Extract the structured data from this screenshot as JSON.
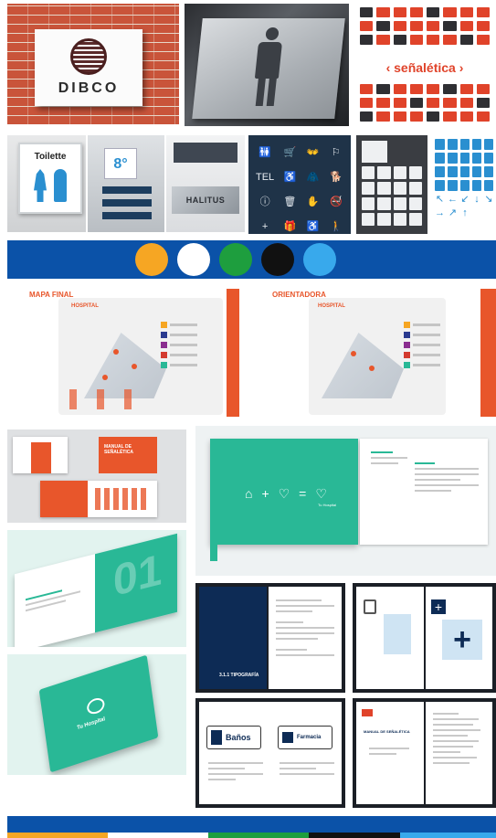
{
  "row1": {
    "brand_sign_text": "DIBCO",
    "senaletica_label": "‹ señalética ›",
    "colors": {
      "sign_red": "#e0432a",
      "sign_dark": "#2f2f33"
    }
  },
  "row2": {
    "toilette_label": "Toilette",
    "floor_label": "8°",
    "halitus_label": "HALITUS",
    "navy_icons": [
      "🚻",
      "🛒",
      "👐",
      "⚐",
      "TEL",
      "♿",
      "🧥",
      "🐕",
      "ⓘ",
      "🗑",
      "✋",
      "🚭",
      "+",
      "🎁",
      "♿",
      "🚶"
    ],
    "blue_arrows": [
      "↖",
      "←",
      "↙",
      "↓",
      "↘",
      "→",
      "↗",
      "↑"
    ]
  },
  "palette": {
    "colors": [
      "#f6a623",
      "#ffffff",
      "#1e9e3e",
      "#111111",
      "#38a9ec"
    ],
    "band_color": "#0b52a8"
  },
  "maps": {
    "left_title": "MAPA FINAL",
    "right_title": "ORIENTADORA",
    "hospital_label": "HOSPITAL",
    "accent": "#e8562b"
  },
  "manual": {
    "cover_title": "MANUAL DE SEÑALÉTICA",
    "brand_name": "Tu Hospital",
    "page_number": "01",
    "section_title": "3.1.1 TIPOGRAFÍA",
    "banos_label": "Baños",
    "farmacia_label": "Farmacia",
    "manual_doc_title": "MANUAL DE SEÑALÉTICA"
  }
}
